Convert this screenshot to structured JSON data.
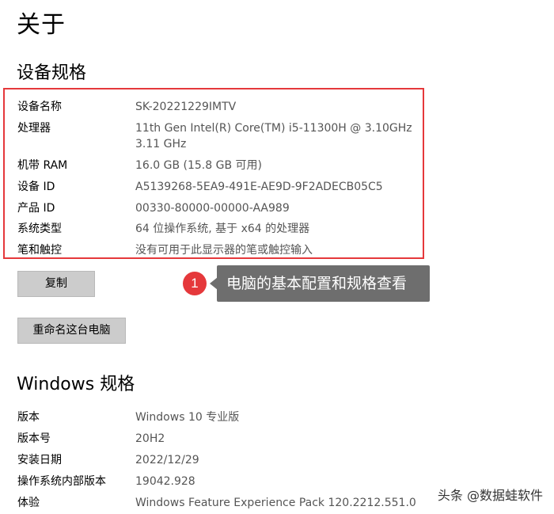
{
  "header": {
    "title": "关于"
  },
  "device_specs": {
    "title": "设备规格",
    "rows": [
      {
        "label": "设备名称",
        "value": "SK-20221229IMTV"
      },
      {
        "label": "处理器",
        "value": "11th Gen Intel(R) Core(TM) i5-11300H @ 3.10GHz",
        "value2": "3.11 GHz"
      },
      {
        "label": "机带 RAM",
        "value": "16.0 GB (15.8 GB 可用)"
      },
      {
        "label": "设备 ID",
        "value": "A5139268-5EA9-491E-AE9D-9F2ADECB05C5"
      },
      {
        "label": "产品 ID",
        "value": "00330-80000-00000-AA989"
      },
      {
        "label": "系统类型",
        "value": "64 位操作系统, 基于 x64 的处理器"
      },
      {
        "label": "笔和触控",
        "value": "没有可用于此显示器的笔或触控输入"
      }
    ],
    "copy_button": "复制",
    "rename_button": "重命名这台电脑"
  },
  "annotation": {
    "badge": "1",
    "text": "电脑的基本配置和规格查看",
    "highlight_color": "#e5383b"
  },
  "windows_specs": {
    "title": "Windows 规格",
    "rows": [
      {
        "label": "版本",
        "value": "Windows 10 专业版"
      },
      {
        "label": "版本号",
        "value": "20H2"
      },
      {
        "label": "安装日期",
        "value": "2022/12/29"
      },
      {
        "label": "操作系统内部版本",
        "value": "19042.928"
      },
      {
        "label": "体验",
        "value": "Windows Feature Experience Pack 120.2212.551.0"
      }
    ]
  },
  "watermark": {
    "text": "头条 @数据蛙软件"
  }
}
